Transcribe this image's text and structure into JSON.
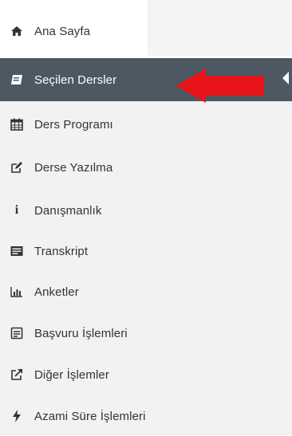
{
  "menu": {
    "items": [
      {
        "label": "Ana Sayfa",
        "icon": "home-icon"
      },
      {
        "label": "Seçilen Dersler",
        "icon": "book-icon",
        "active": true
      },
      {
        "label": "Ders Programı",
        "icon": "calendar-icon"
      },
      {
        "label": "Derse Yazılma",
        "icon": "edit-icon"
      },
      {
        "label": "Danışmanlık",
        "icon": "info-icon"
      },
      {
        "label": "Transkript",
        "icon": "id-card-icon"
      },
      {
        "label": "Anketler",
        "icon": "bar-chart-icon"
      },
      {
        "label": "Başvuru İşlemleri",
        "icon": "document-icon"
      },
      {
        "label": "Diğer İşlemler",
        "icon": "external-link-icon"
      },
      {
        "label": "Azami Süre İşlemleri",
        "icon": "bolt-icon"
      }
    ]
  },
  "colors": {
    "active_bg": "#4d5862",
    "sidebar_bg": "#f2f2f2",
    "text": "#333333",
    "arrow": "#e8131b"
  }
}
